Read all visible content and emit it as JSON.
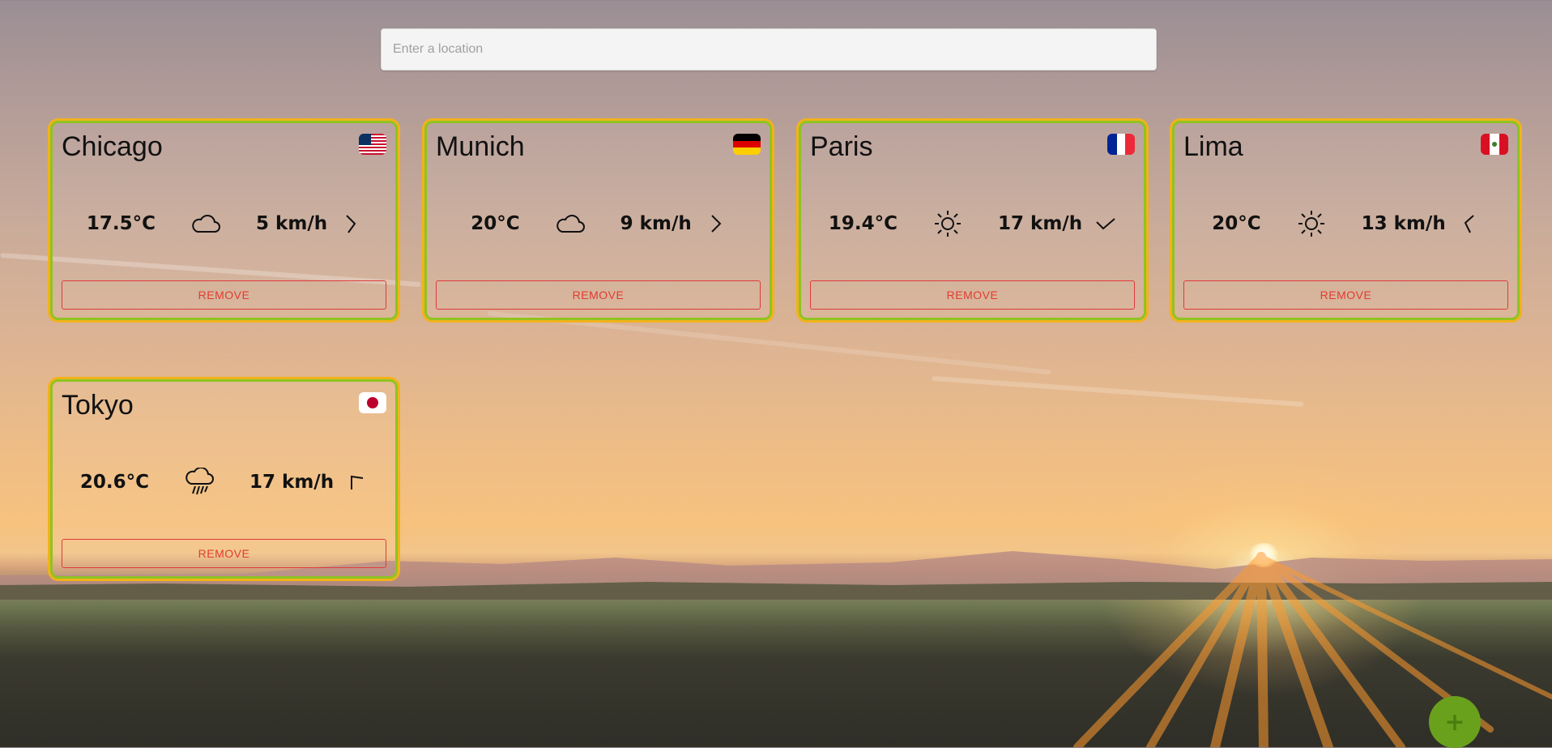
{
  "search": {
    "placeholder": "Enter a location",
    "value": ""
  },
  "cards": [
    {
      "city": "Chicago",
      "country_flag": "us-flag-icon",
      "temperature": "17.5°C",
      "weather_icon": "cloud-icon",
      "wind": "5 km/h",
      "wind_direction_icon": "wind-arrow-icon",
      "remove_label": "REMOVE"
    },
    {
      "city": "Munich",
      "country_flag": "germany-flag-icon",
      "temperature": "20°C",
      "weather_icon": "cloud-icon",
      "wind": "9 km/h",
      "wind_direction_icon": "wind-arrow-icon",
      "remove_label": "REMOVE"
    },
    {
      "city": "Paris",
      "country_flag": "france-flag-icon",
      "temperature": "19.4°C",
      "weather_icon": "sun-icon",
      "wind": "17 km/h",
      "wind_direction_icon": "wind-arrow-icon",
      "remove_label": "REMOVE"
    },
    {
      "city": "Lima",
      "country_flag": "peru-flag-icon",
      "temperature": "20°C",
      "weather_icon": "sun-icon",
      "wind": "13 km/h",
      "wind_direction_icon": "wind-arrow-icon",
      "remove_label": "REMOVE"
    },
    {
      "city": "Tokyo",
      "country_flag": "japan-flag-icon",
      "temperature": "20.6°C",
      "weather_icon": "rain-cloud-icon",
      "wind": "17 km/h",
      "wind_direction_icon": "wind-arrow-icon",
      "remove_label": "REMOVE"
    }
  ],
  "fab": {
    "label": "+",
    "icon": "plus-icon"
  },
  "colors": {
    "card_border_inner": "#8fc322",
    "card_border_outer": "#f2b21a",
    "remove": "#e33b2e",
    "fab": "#6aa11c"
  }
}
